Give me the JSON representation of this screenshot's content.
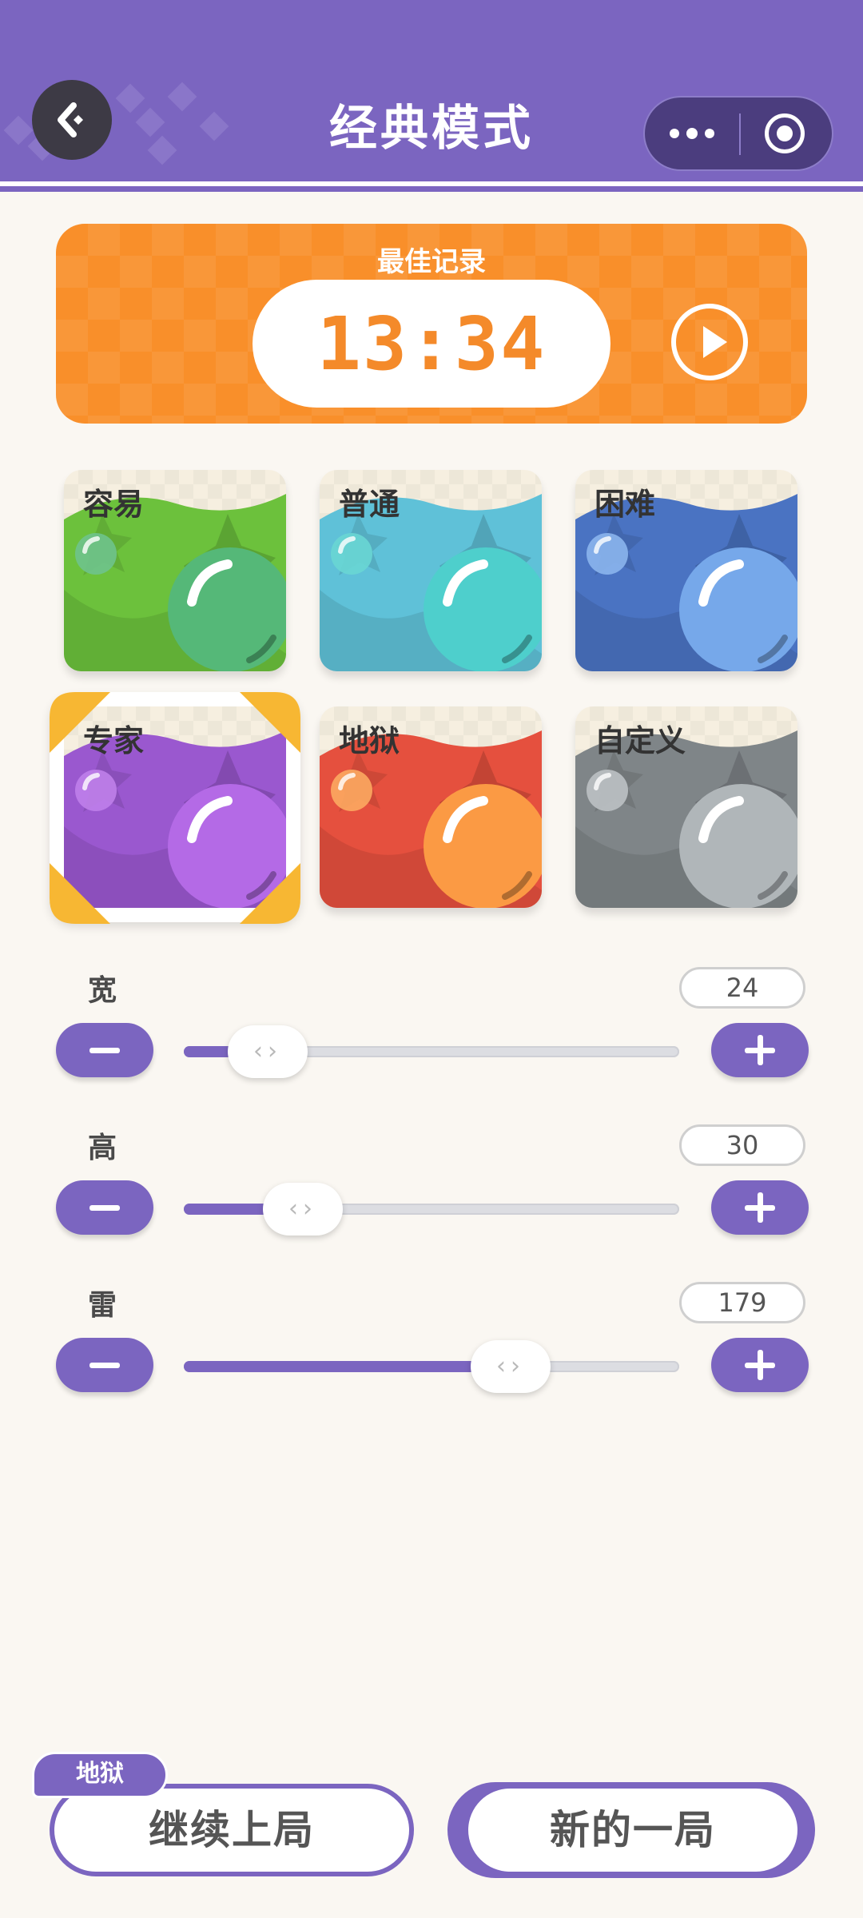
{
  "header": {
    "title": "经典模式",
    "back_icon": "back-arrow-icon",
    "more_icon": "more-dots-icon",
    "close_icon": "target-close-icon"
  },
  "best_record": {
    "label": "最佳记录",
    "time": "13:34",
    "replay_icon": "play-icon"
  },
  "difficulties": [
    {
      "label": "容易",
      "color": "#6cc13c",
      "selected": false
    },
    {
      "label": "普通",
      "color": "#5fc1d8",
      "selected": false
    },
    {
      "label": "困难",
      "color": "#4a73c2",
      "selected": false
    },
    {
      "label": "专家",
      "color": "#9a58cf",
      "selected": true
    },
    {
      "label": "地狱",
      "color": "#e5503e",
      "selected": false
    },
    {
      "label": "自定义",
      "color": "#7f8588",
      "selected": false
    }
  ],
  "sliders": [
    {
      "label": "宽",
      "value": "24",
      "fill_fraction": 0.17
    },
    {
      "label": "高",
      "value": "30",
      "fill_fraction": 0.24
    },
    {
      "label": "雷",
      "value": "179",
      "fill_fraction": 0.66
    }
  ],
  "bottom": {
    "continue_tag": "地狱",
    "continue_label": "继续上局",
    "new_label": "新的一局"
  },
  "colors": {
    "accent": "#7b65c0",
    "record_bg": "#f98f2a",
    "page_bg": "#faf7f2"
  }
}
